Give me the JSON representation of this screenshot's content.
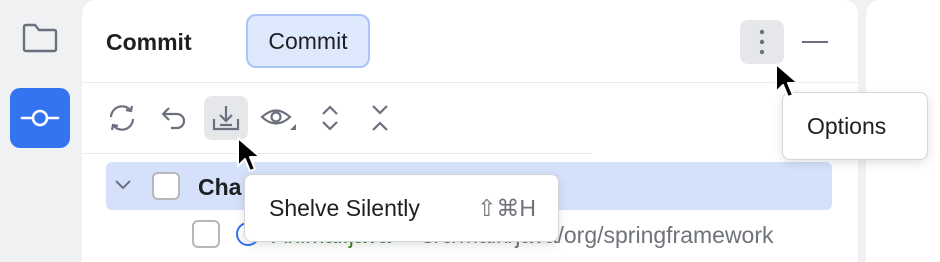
{
  "tool_window_bar": {
    "items": [
      {
        "icon": "folder-icon",
        "active": false
      },
      {
        "icon": "commit-icon",
        "active": true
      }
    ]
  },
  "commit_panel": {
    "title": "Commit",
    "tab_label": "Commit",
    "header_icons": [
      "more-vertical-icon",
      "minimize-icon"
    ],
    "toolbar_icons": [
      "refresh-icon",
      "rollback-icon",
      "shelve-icon",
      "eye-icon",
      "expand-all-icon",
      "collapse-all-icon"
    ],
    "changes_group": {
      "label": "Cha"
    },
    "file": {
      "name": "Animal.java",
      "path": "src/main/java/org/springframework"
    }
  },
  "tooltips": {
    "shelve": {
      "label": "Shelve Silently",
      "shortcut": "⇧⌘H"
    },
    "options": {
      "label": "Options"
    }
  },
  "colors": {
    "accent": "#3574f0",
    "selection": "#d5e1fb",
    "tab_background": "#dfe9fd",
    "file_added": "#3b8a2d"
  }
}
